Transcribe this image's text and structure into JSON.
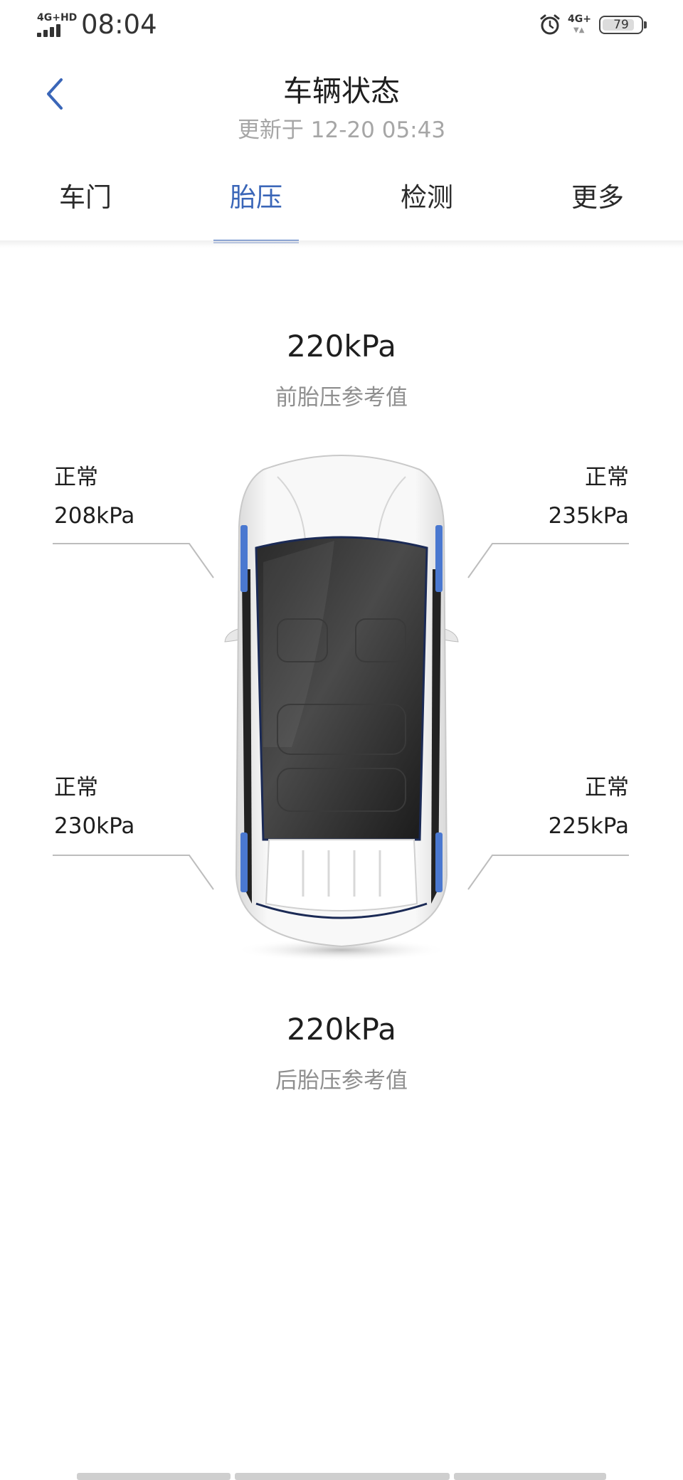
{
  "status_bar": {
    "network": "4G+HD",
    "time": "08:04",
    "network_right": "4G+",
    "battery_level": "79",
    "icons": [
      "signal-icon",
      "alarm-icon",
      "battery-icon"
    ]
  },
  "header": {
    "title": "车辆状态",
    "updated": "更新于 12-20 05:43",
    "back_icon": "chevron-left-icon"
  },
  "tabs": [
    {
      "label": "车门",
      "active": false
    },
    {
      "label": "胎压",
      "active": true
    },
    {
      "label": "检测",
      "active": false
    },
    {
      "label": "更多",
      "active": false
    }
  ],
  "reference": {
    "front": {
      "value": "220kPa",
      "label": "前胎压参考值"
    },
    "rear": {
      "value": "220kPa",
      "label": "后胎压参考值"
    }
  },
  "tires": {
    "front_left": {
      "status": "正常",
      "pressure": "208kPa"
    },
    "front_right": {
      "status": "正常",
      "pressure": "235kPa"
    },
    "rear_left": {
      "status": "正常",
      "pressure": "230kPa"
    },
    "rear_right": {
      "status": "正常",
      "pressure": "225kPa"
    }
  },
  "colors": {
    "accent": "#3a66b8",
    "tire_highlight": "#4a78d0",
    "muted_text": "#8f8f8f"
  }
}
